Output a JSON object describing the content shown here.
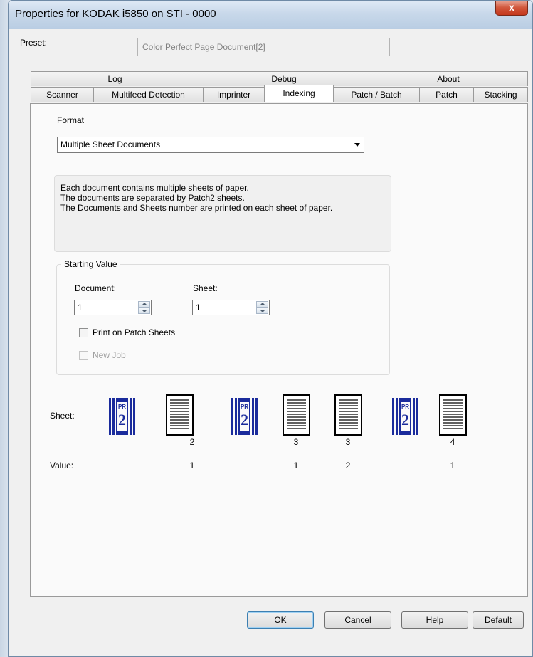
{
  "window": {
    "title": "Properties for KODAK i5850 on STI - 0000",
    "close_label": "x"
  },
  "preset": {
    "label": "Preset:",
    "value": "Color Perfect Page Document[2]"
  },
  "tabs_row1": [
    "Log",
    "Debug",
    "About"
  ],
  "tabs_row2": [
    "Scanner",
    "Multifeed Detection",
    "Imprinter",
    "Indexing",
    "Patch / Batch",
    "Patch",
    "Stacking"
  ],
  "active_tab": "Indexing",
  "format": {
    "label": "Format",
    "selected": "Multiple Sheet Documents"
  },
  "description": {
    "line1": "Each document contains multiple sheets of paper.",
    "line2": "The documents are separated by Patch2  sheets.",
    "line3": "The Documents and Sheets number are printed on each sheet of paper."
  },
  "starting_value": {
    "title": "Starting Value",
    "document_label": "Document:",
    "document_value": "1",
    "sheet_label": "Sheet:",
    "sheet_value": "1",
    "print_on_patch_label": "Print on Patch Sheets",
    "print_on_patch_checked": false,
    "new_job_label": "New Job",
    "new_job_checked": false
  },
  "diagram": {
    "sheet_label": "Sheet:",
    "value_label": "Value:",
    "patch_text_top": "PR",
    "patch_text_num": "2",
    "items": [
      {
        "kind": "patch",
        "doc": "",
        "value": ""
      },
      {
        "kind": "sheet",
        "doc": "2",
        "value": "1"
      },
      {
        "kind": "patch",
        "doc": "",
        "value": ""
      },
      {
        "kind": "sheet",
        "doc": "3",
        "value": "1"
      },
      {
        "kind": "sheet",
        "doc": "3",
        "value": "2"
      },
      {
        "kind": "patch",
        "doc": "",
        "value": ""
      },
      {
        "kind": "sheet",
        "doc": "4",
        "value": "1"
      }
    ]
  },
  "buttons": {
    "ok": "OK",
    "cancel": "Cancel",
    "help": "Help",
    "default": "Default"
  },
  "colors": {
    "patch_blue": "#1a2b9c",
    "title_bar": "#c8d8ea",
    "close_red": "#c4371c"
  }
}
